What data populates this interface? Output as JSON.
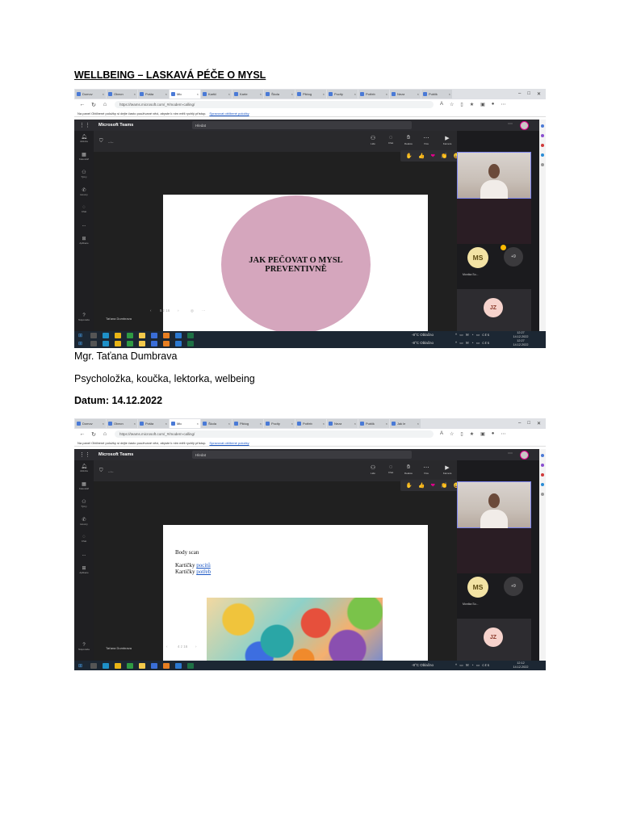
{
  "document": {
    "title": "WELLBEING – LASKAVÁ PÉČE O MYSL",
    "author": "Mgr. Taťana Dumbrava",
    "role": "Psycholožka, koučka, lektorka, welbeing",
    "date": "Datum: 14.12.2022"
  },
  "browser": {
    "url": "https://teams.microsoft.com/_#/modern-calling/",
    "favorites_bar_text": "Na panel Oblíbené položky si dejte často používané věci, abyste k nim měli rychlý přístup.",
    "favorites_bar_link": "Spravovat oblíbené položky",
    "tabs": [
      "Domov",
      "Obecn",
      "Pošta",
      "Mic",
      "Kartič",
      "Karte",
      "Škola",
      "Piktog",
      "Pocity",
      "Potřeb",
      "Neza",
      "Publik",
      "Jak le"
    ]
  },
  "teams": {
    "app_name": "Microsoft Teams",
    "search_placeholder": "Hledat",
    "rail": [
      {
        "icon": "activity-icon",
        "label": "Aktivita"
      },
      {
        "icon": "calendar-icon",
        "label": "Kalendář"
      },
      {
        "icon": "teams-icon",
        "label": "Týmy"
      },
      {
        "icon": "calls-icon",
        "label": "Hovory"
      },
      {
        "icon": "chat-icon",
        "label": "Chat"
      },
      {
        "icon": "more-icon",
        "label": "..."
      },
      {
        "icon": "apps-icon",
        "label": "Aplikace"
      },
      {
        "icon": "help-icon",
        "label": "Nápověda"
      }
    ],
    "controls": [
      "Lidé",
      "Chat",
      "Reakce",
      "Více",
      "Kamera",
      "Mikrofon",
      "Sdílet"
    ],
    "leave_label": "Odejít",
    "reactions": [
      "✋",
      "👍",
      "❤",
      "👏",
      "😄",
      "😮"
    ],
    "presenter_name": "Taťana Dumbrava",
    "participant_ms_initials": "MS",
    "participant_ms_name": "Monika So...",
    "participant_more": "+9",
    "participant_jz_initials": "JZ"
  },
  "shot1": {
    "timer": "--:--",
    "slide_line1": "JAK PEČOVAT O MYSL",
    "slide_line2": "PREVENTIVNĚ",
    "pager": "5 z 16",
    "weather": "-8°C  Oblačno",
    "clock_time": "12:27",
    "clock_date": "14.12.2022"
  },
  "shot2": {
    "timer": "--:--",
    "slide_heading": "Body scan",
    "slide_prefix1": "Kartičky ",
    "slide_link1": "pocitů",
    "slide_prefix2": "Kartičky ",
    "slide_link2": "potřeb",
    "pager": "4 z 16",
    "weather": "-8°C  Oblačno",
    "clock_time": "12:12",
    "clock_date": "14.12.2022"
  }
}
